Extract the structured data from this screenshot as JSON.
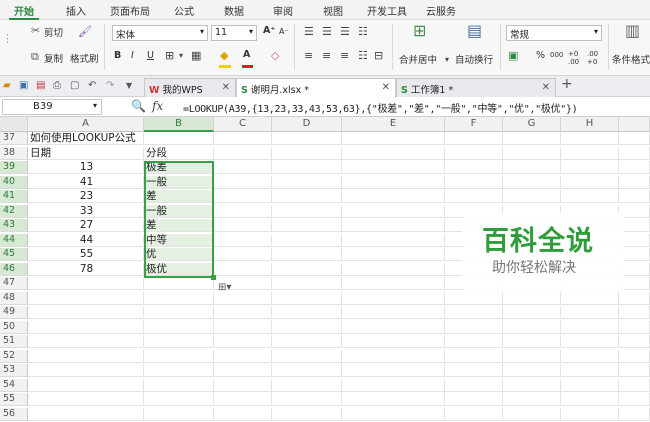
{
  "menu": {
    "tabs": [
      "开始",
      "插入",
      "页面布局",
      "公式",
      "数据",
      "审阅",
      "视图",
      "开发工具",
      "云服务"
    ]
  },
  "ribbon": {
    "cut": "剪切",
    "copy": "复制",
    "format_painter": "格式刷",
    "font_name": "宋体",
    "font_size": "11",
    "merge_center": "合并居中",
    "wrap_text": "自动换行",
    "number_format": "常规",
    "conditional_format": "条件格式",
    "bold": "B",
    "italic": "I",
    "underline": "U",
    "grow_font": "A",
    "shrink_font": "A",
    "percent": "%",
    "thousands": "000",
    "inc_decimal": "+0 .00",
    "dec_decimal": ".00 +0"
  },
  "tabs": {
    "doc_tabs": [
      {
        "label": "我的WPS",
        "icon": "W"
      },
      {
        "label": "谢明月.xlsx *",
        "icon": "S"
      },
      {
        "label": "工作簿1 *",
        "icon": "S"
      }
    ],
    "new_tab": "+"
  },
  "formula_bar": {
    "name_box": "B39",
    "fx": "fx",
    "formula": "=LOOKUP(A39,{13,23,33,43,53,63},{\"极差\",\"差\",\"一般\",\"中等\",\"优\",\"极优\"})"
  },
  "columns": [
    "A",
    "B",
    "C",
    "D",
    "E",
    "F",
    "G",
    "H"
  ],
  "rows": [
    {
      "num": "37",
      "a": "如何使用LOOKUP公式",
      "b": ""
    },
    {
      "num": "38",
      "a": "日期",
      "b": "分段"
    },
    {
      "num": "39",
      "a": "13",
      "b": "极差"
    },
    {
      "num": "40",
      "a": "41",
      "b": "一般"
    },
    {
      "num": "41",
      "a": "23",
      "b": "差"
    },
    {
      "num": "42",
      "a": "33",
      "b": "一般"
    },
    {
      "num": "43",
      "a": "27",
      "b": "差"
    },
    {
      "num": "44",
      "a": "44",
      "b": "中等"
    },
    {
      "num": "45",
      "a": "55",
      "b": "优"
    },
    {
      "num": "46",
      "a": "78",
      "b": "极优"
    },
    {
      "num": "47",
      "a": "",
      "b": ""
    },
    {
      "num": "48",
      "a": "",
      "b": ""
    },
    {
      "num": "49",
      "a": "",
      "b": ""
    },
    {
      "num": "50",
      "a": "",
      "b": ""
    },
    {
      "num": "51",
      "a": "",
      "b": ""
    },
    {
      "num": "52",
      "a": "",
      "b": ""
    },
    {
      "num": "53",
      "a": "",
      "b": ""
    },
    {
      "num": "54",
      "a": "",
      "b": ""
    },
    {
      "num": "55",
      "a": "",
      "b": ""
    },
    {
      "num": "56",
      "a": "",
      "b": ""
    }
  ],
  "watermark": {
    "title": "百科全说",
    "subtitle": "助你轻松解决"
  },
  "colors": {
    "accent": "#2d8a3e",
    "selection": "#3aa048",
    "selection_fill": "#e4f1e2"
  }
}
